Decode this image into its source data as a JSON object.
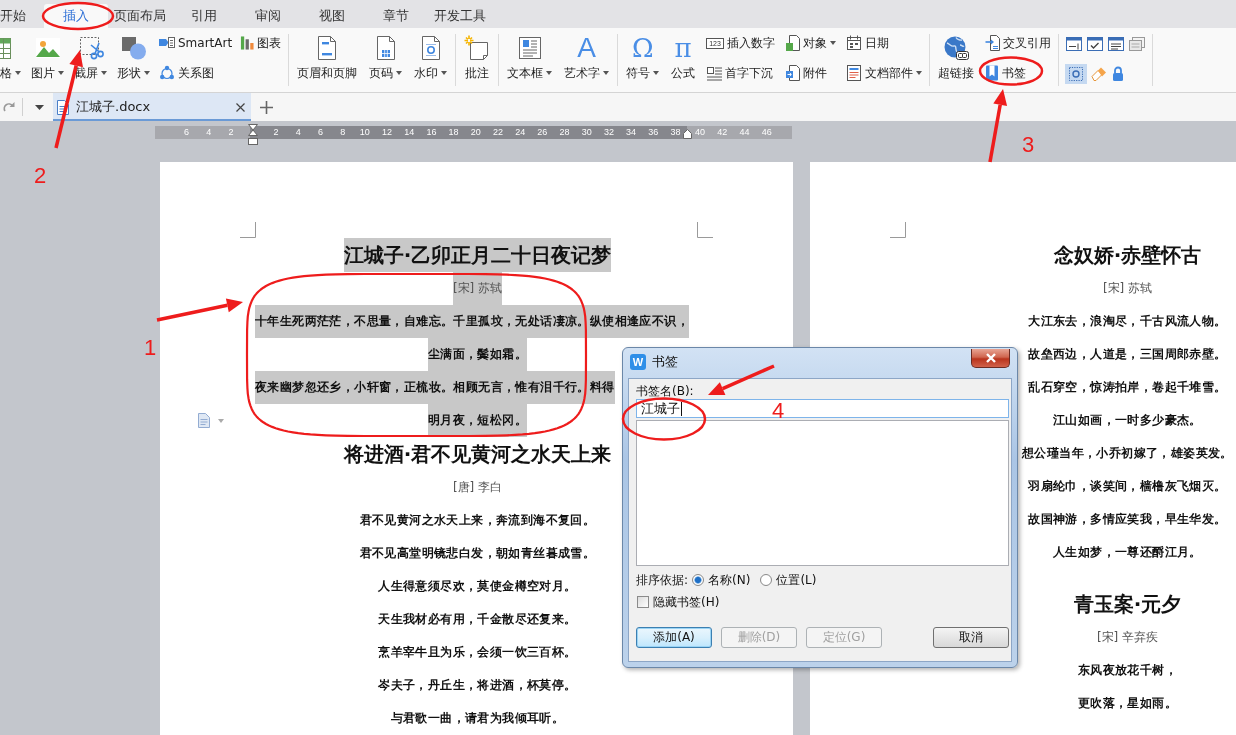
{
  "menu_tabs": [
    {
      "label": "开始",
      "selected": false
    },
    {
      "label": "插入",
      "selected": true
    },
    {
      "label": "页面布局",
      "selected": false
    },
    {
      "label": "引用",
      "selected": false
    },
    {
      "label": "审阅",
      "selected": false
    },
    {
      "label": "视图",
      "selected": false
    },
    {
      "label": "章节",
      "selected": false
    },
    {
      "label": "开发工具",
      "selected": false
    }
  ],
  "ribbon": {
    "groups": [
      {
        "items": [
          {
            "kind": "large",
            "label": "格",
            "dropdown": true
          },
          {
            "kind": "large",
            "label": "图片",
            "dropdown": true
          },
          {
            "kind": "large",
            "label": "截屏",
            "dropdown": true
          },
          {
            "kind": "large",
            "label": "形状",
            "dropdown": true
          },
          {
            "kind": "stack",
            "buttons": [
              {
                "label": "SmartArt",
                "dropdown": false
              },
              {
                "label": "关系图",
                "dropdown": false
              }
            ]
          },
          {
            "kind": "stack",
            "buttons": [
              {
                "label": "图表",
                "dropdown": false
              }
            ]
          }
        ]
      },
      {
        "items": [
          {
            "kind": "large",
            "label": "页眉和页脚",
            "dropdown": false
          },
          {
            "kind": "large",
            "label": "页码",
            "dropdown": true
          },
          {
            "kind": "large",
            "label": "水印",
            "dropdown": true
          }
        ]
      },
      {
        "items": [
          {
            "kind": "large",
            "label": "批注",
            "dropdown": false
          }
        ]
      },
      {
        "items": [
          {
            "kind": "large",
            "label": "文本框",
            "dropdown": true
          },
          {
            "kind": "large",
            "label": "艺术字",
            "dropdown": true,
            "glyph": "A"
          }
        ]
      },
      {
        "items": [
          {
            "kind": "large",
            "label": "符号",
            "dropdown": true,
            "glyph": "Ω"
          },
          {
            "kind": "large",
            "label": "公式",
            "dropdown": false,
            "glyph": "π"
          },
          {
            "kind": "stack",
            "buttons": [
              {
                "label": "插入数字",
                "dropdown": false,
                "glyph": "123"
              },
              {
                "label": "首字下沉",
                "dropdown": false
              }
            ]
          },
          {
            "kind": "stack",
            "buttons": [
              {
                "label": "对象",
                "dropdown": true
              },
              {
                "label": "附件",
                "dropdown": false
              }
            ]
          },
          {
            "kind": "stack",
            "buttons": [
              {
                "label": "日期",
                "dropdown": false
              },
              {
                "label": "文档部件",
                "dropdown": true
              }
            ]
          }
        ]
      },
      {
        "items": [
          {
            "kind": "large",
            "label": "超链接",
            "dropdown": false
          },
          {
            "kind": "stack",
            "buttons": [
              {
                "label": "交叉引用",
                "dropdown": false
              },
              {
                "label": "书签",
                "dropdown": false
              }
            ]
          }
        ]
      },
      {
        "items": [
          {
            "kind": "icon_grid",
            "rows": [
              [
                {
                  "selected": false
                },
                {
                  "selected": false
                },
                {
                  "selected": false
                },
                {
                  "selected": false
                }
              ],
              [
                {
                  "selected": true
                },
                {
                  "selected": false
                },
                {
                  "selected": false
                }
              ]
            ]
          }
        ]
      }
    ]
  },
  "doc_tabs": [
    {
      "label": "江城子.docx",
      "selected": true
    }
  ],
  "ruler": {
    "left_numbers": [
      "6",
      "4",
      "2"
    ],
    "numbers": [
      "2",
      "4",
      "6",
      "8",
      "10",
      "12",
      "14",
      "16",
      "18",
      "20",
      "22",
      "24",
      "26",
      "28",
      "30",
      "32",
      "34",
      "36",
      "38"
    ],
    "right_numbers": [
      "40",
      "42",
      "44",
      "46"
    ]
  },
  "pages": [
    {
      "poems": [
        {
          "title": "江城子·乙卯正月二十日夜记梦",
          "author": "[宋] 苏轼",
          "highlighted": true,
          "lines": [
            {
              "kind": "full",
              "text": "十年生死两茫茫，不思量，自难忘。千里孤坟，无处话凄凉。纵使相逢应不识，"
            },
            {
              "kind": "centered",
              "text": "尘满面，鬓如霜。"
            },
            {
              "kind": "full",
              "text": "夜来幽梦忽还乡，小轩窗，正梳妆。相顾无言，惟有泪千行。料得"
            },
            {
              "kind": "centered",
              "text": "明月夜，短松冈。"
            }
          ]
        },
        {
          "title": "将进酒·君不见黄河之水天上来",
          "author": "[唐] 李白",
          "highlighted": false,
          "lines": [
            {
              "kind": "centered",
              "text": "君不见黄河之水天上来，奔流到海不复回。"
            },
            {
              "kind": "centered",
              "text": "君不见高堂明镜悲白发，朝如青丝暮成雪。"
            },
            {
              "kind": "centered",
              "text": "人生得意须尽欢，莫使金樽空对月。"
            },
            {
              "kind": "centered",
              "text": "天生我材必有用，千金散尽还复来。"
            },
            {
              "kind": "centered",
              "text": "烹羊宰牛且为乐，会须一饮三百杯。"
            },
            {
              "kind": "centered",
              "text": "岑夫子，丹丘生，将进酒，杯莫停。"
            },
            {
              "kind": "centered",
              "text": "与君歌一曲，请君为我倾耳听。"
            }
          ]
        }
      ]
    },
    {
      "poems": [
        {
          "title": "念奴娇·赤壁怀古",
          "author": "[宋] 苏轼",
          "highlighted": false,
          "lines": [
            {
              "kind": "centered",
              "text": "大江东去，浪淘尽，千古风流人物。"
            },
            {
              "kind": "centered",
              "text": "故垒西边，人道是，三国周郎赤壁。"
            },
            {
              "kind": "centered",
              "text": "乱石穿空，惊涛拍岸，卷起千堆雪。"
            },
            {
              "kind": "centered",
              "text": "江山如画，一时多少豪杰。"
            },
            {
              "kind": "centered",
              "text": "想公瑾当年，小乔初嫁了，雄姿英发。"
            },
            {
              "kind": "centered",
              "text": "羽扇纶巾，谈笑间，樯橹灰飞烟灭。"
            },
            {
              "kind": "centered",
              "text": "故国神游，多情应笑我，早生华发。"
            },
            {
              "kind": "centered",
              "text": "人生如梦，一尊还酹江月。"
            }
          ]
        },
        {
          "title": "青玉案·元夕",
          "author": "[宋] 辛弃疾",
          "highlighted": false,
          "lines": [
            {
              "kind": "centered",
              "text": "东风夜放花千树，"
            },
            {
              "kind": "centered",
              "text": "更吹落，星如雨。"
            }
          ]
        }
      ]
    }
  ],
  "dialog": {
    "icon_letter": "W",
    "title": "书签",
    "name_label": "书签名(B):",
    "name_value": "江城子",
    "sort_label": "排序依据:",
    "sort_options": [
      {
        "label": "名称(N)",
        "selected": true
      },
      {
        "label": "位置(L)",
        "selected": false
      }
    ],
    "hide_option": {
      "label": "隐藏书签(H)",
      "checked": false
    },
    "buttons": [
      {
        "label": "添加(A)",
        "disabled": false,
        "default": true
      },
      {
        "label": "删除(D)",
        "disabled": true,
        "default": false
      },
      {
        "label": "定位(G)",
        "disabled": true,
        "default": false
      },
      {
        "label": "取消",
        "disabled": false,
        "default": false
      }
    ]
  },
  "annotations": [
    {
      "label": "1"
    },
    {
      "label": "2"
    },
    {
      "label": "3"
    },
    {
      "label": "4"
    }
  ]
}
